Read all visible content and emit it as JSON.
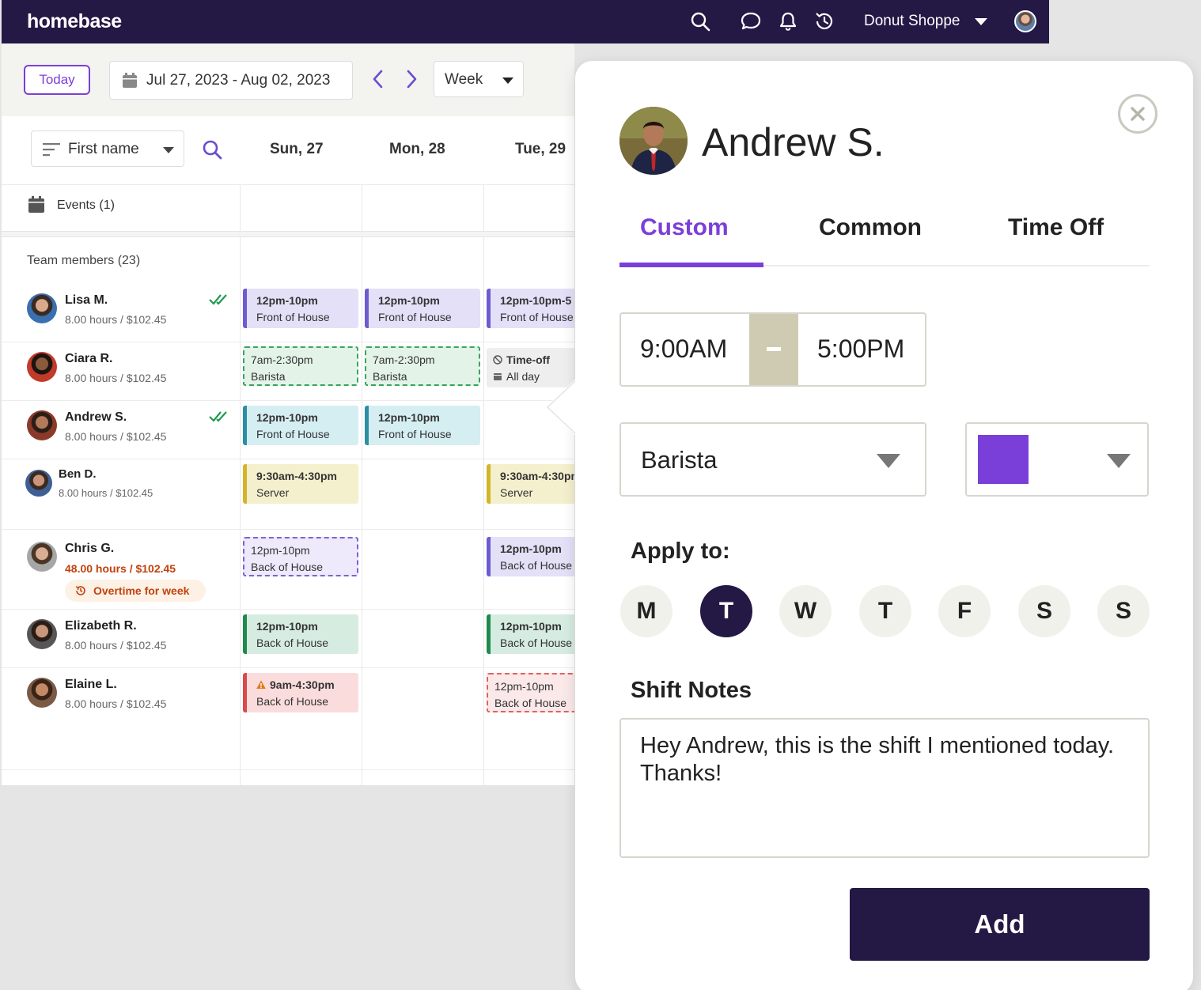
{
  "brand": "homebase",
  "header": {
    "shop_name": "Donut Shoppe",
    "icons": [
      "search-icon",
      "chat-icon",
      "bell-icon",
      "history-icon"
    ]
  },
  "toolbar": {
    "today_label": "Today",
    "date_range": "Jul 27, 2023 - Aug 02, 2023",
    "view_label": "Week",
    "sort_label": "First name"
  },
  "days": [
    "Sun, 27",
    "Mon, 28",
    "Tue, 29"
  ],
  "events_label": "Events (1)",
  "team_label": "Team members (23)",
  "members": [
    {
      "name": "Lisa M.",
      "hours": "8.00 hours / $102.45"
    },
    {
      "name": "Ciara R.",
      "hours": "8.00 hours / $102.45"
    },
    {
      "name": "Andrew S.",
      "hours": "8.00 hours / $102.45"
    },
    {
      "name": "Ben D.",
      "hours": "8.00 hours / $102.45"
    },
    {
      "name": "Chris G.",
      "hours": "48.00 hours / $102.45",
      "badge": "Overtime for week"
    },
    {
      "name": "Elizabeth R.",
      "hours": "8.00 hours / $102.45"
    },
    {
      "name": "Elaine L.",
      "hours": "8.00 hours / $102.45"
    }
  ],
  "shifts": {
    "lisa": [
      {
        "time": "12pm-10pm",
        "role": "Front of House"
      },
      {
        "time": "12pm-10pm",
        "role": "Front of House"
      },
      {
        "time": "12pm-10pm-5",
        "role": "Front of House"
      }
    ],
    "ciara": [
      {
        "time": "7am-2:30pm",
        "role": "Barista"
      },
      {
        "time": "7am-2:30pm",
        "role": "Barista"
      },
      {
        "time": "Time-off",
        "role": "All day"
      }
    ],
    "andrew": [
      {
        "time": "12pm-10pm",
        "role": "Front of House"
      },
      {
        "time": "12pm-10pm",
        "role": "Front of House"
      }
    ],
    "ben": [
      {
        "time": "9:30am-4:30pm",
        "role": "Server"
      },
      {
        "time": "9:30am-4:30pm",
        "role": "Server"
      }
    ],
    "chris": [
      {
        "time": "12pm-10pm",
        "role": "Back of House"
      },
      {
        "time": "12pm-10pm",
        "role": "Back of House"
      }
    ],
    "elizabeth": [
      {
        "time": "12pm-10pm",
        "role": "Back of House"
      },
      {
        "time": "12pm-10pm",
        "role": "Back of House"
      }
    ],
    "elaine": [
      {
        "time": "9am-4:30pm",
        "role": "Back of House"
      },
      {
        "time": "12pm-10pm",
        "role": "Back of House"
      }
    ]
  },
  "panel": {
    "employee_name": "Andrew S.",
    "tabs": [
      "Custom",
      "Common",
      "Time Off"
    ],
    "active_tab": "Custom",
    "start_time": "9:00AM",
    "end_time": "5:00PM",
    "role": "Barista",
    "color": "#7b3fd9",
    "apply_label": "Apply to:",
    "weekdays": [
      "M",
      "T",
      "W",
      "T",
      "F",
      "S",
      "S"
    ],
    "selected_weekday_index": 1,
    "notes_label": "Shift Notes",
    "notes": "Hey Andrew, this is the shift I mentioned today. Thanks!",
    "add_label": "Add"
  },
  "colors": {
    "brand_dark": "#241845",
    "accent_purple": "#7b3fd9",
    "overtime_orange": "#c2410c"
  }
}
